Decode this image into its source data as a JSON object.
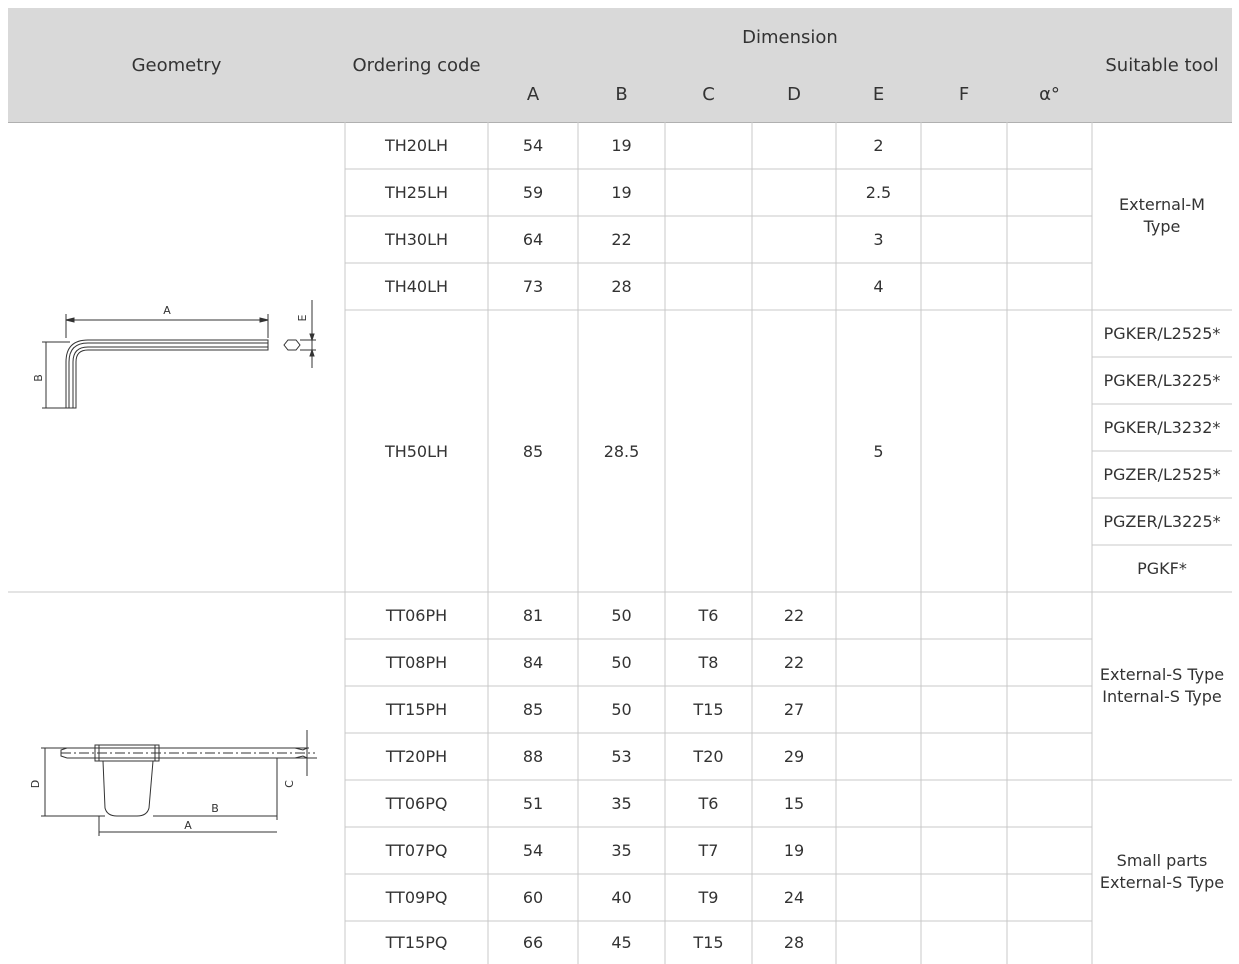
{
  "header": {
    "geometry": "Geometry",
    "ordering_code": "Ordering code",
    "dimension": "Dimension",
    "dims": [
      "A",
      "B",
      "C",
      "D",
      "E",
      "F",
      "α°"
    ],
    "suitable_tool": "Suitable tool"
  },
  "rows": [
    {
      "code": "TH20LH",
      "A": "54",
      "B": "19",
      "C": "",
      "D": "",
      "E": "2",
      "F": "",
      "alpha": ""
    },
    {
      "code": "TH25LH",
      "A": "59",
      "B": "19",
      "C": "",
      "D": "",
      "E": "2.5",
      "F": "",
      "alpha": ""
    },
    {
      "code": "TH30LH",
      "A": "64",
      "B": "22",
      "C": "",
      "D": "",
      "E": "3",
      "F": "",
      "alpha": ""
    },
    {
      "code": "TH40LH",
      "A": "73",
      "B": "28",
      "C": "",
      "D": "",
      "E": "4",
      "F": "",
      "alpha": ""
    },
    {
      "code": "TH50LH",
      "A": "85",
      "B": "28.5",
      "C": "",
      "D": "",
      "E": "5",
      "F": "",
      "alpha": ""
    },
    {
      "code": "TT06PH",
      "A": "81",
      "B": "50",
      "C": "T6",
      "D": "22",
      "E": "",
      "F": "",
      "alpha": ""
    },
    {
      "code": "TT08PH",
      "A": "84",
      "B": "50",
      "C": "T8",
      "D": "22",
      "E": "",
      "F": "",
      "alpha": ""
    },
    {
      "code": "TT15PH",
      "A": "85",
      "B": "50",
      "C": "T15",
      "D": "27",
      "E": "",
      "F": "",
      "alpha": ""
    },
    {
      "code": "TT20PH",
      "A": "88",
      "B": "53",
      "C": "T20",
      "D": "29",
      "E": "",
      "F": "",
      "alpha": ""
    },
    {
      "code": "TT06PQ",
      "A": "51",
      "B": "35",
      "C": "T6",
      "D": "15",
      "E": "",
      "F": "",
      "alpha": ""
    },
    {
      "code": "TT07PQ",
      "A": "54",
      "B": "35",
      "C": "T7",
      "D": "19",
      "E": "",
      "F": "",
      "alpha": ""
    },
    {
      "code": "TT09PQ",
      "A": "60",
      "B": "40",
      "C": "T9",
      "D": "24",
      "E": "",
      "F": "",
      "alpha": ""
    },
    {
      "code": "TT15PQ",
      "A": "66",
      "B": "45",
      "C": "T15",
      "D": "28",
      "E": "",
      "F": "",
      "alpha": ""
    }
  ],
  "tools": {
    "external_m": [
      "External-M",
      "Type"
    ],
    "th50_tools": [
      "PGKER/L2525*",
      "PGKER/L3225*",
      "PGKER/L3232*",
      "PGZER/L2525*",
      "PGZER/L3225*",
      "PGKF*"
    ],
    "external_internal_s": [
      "External-S Type",
      "Internal-S Type"
    ],
    "small_parts": [
      "Small parts",
      "External-S Type"
    ]
  },
  "drawings": {
    "hex_key": {
      "A": "A",
      "B": "B",
      "E": "E"
    },
    "torx_key": {
      "A": "A",
      "B": "B",
      "C": "C",
      "D": "D"
    }
  },
  "colors": {
    "header_bg": "#d9d9d9",
    "grid_line": "#c8c8c8",
    "text": "#333333"
  }
}
